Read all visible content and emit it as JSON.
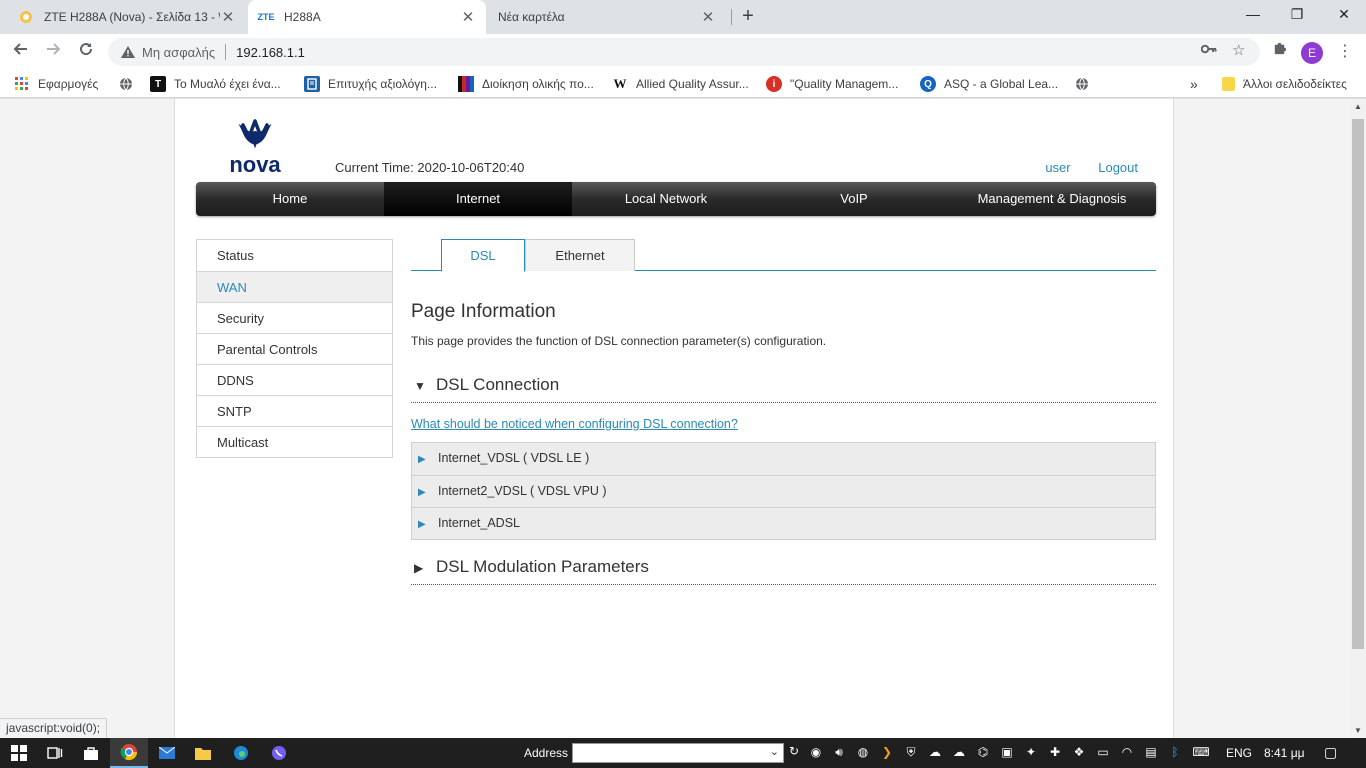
{
  "browser": {
    "tabs": [
      {
        "title": "ZTE H288A (Nova) - Σελίδα 13 - \\",
        "favicon": "forum-favicon",
        "active": false
      },
      {
        "title": "H288A",
        "favicon": "zte-favicon",
        "favicon_text": "ZTE",
        "active": true
      },
      {
        "title": "Νέα καρτέλα",
        "active": false
      }
    ],
    "new_tab": "+",
    "window_controls": {
      "minimize": "—",
      "restore": "❐",
      "close": "✕"
    },
    "omnibox": {
      "security_label": "Μη ασφαλής",
      "url": "192.168.1.1"
    },
    "profile_initial": "E",
    "bookmarks": [
      {
        "label": "Εφαρμογές",
        "icon": "apps-grid-icon"
      },
      {
        "label": "",
        "icon": "globe-icon"
      },
      {
        "label": "Το Μυαλό έχει ένα...",
        "icon": "t-logo-icon",
        "icon_text": "T",
        "color": "#111111"
      },
      {
        "label": "Επιτυχής αξιολόγη...",
        "icon": "book-icon",
        "color": "#1f5fa8"
      },
      {
        "label": "Διοίκηση ολικής πο...",
        "icon": "stripes-icon",
        "color": "#6a1b9a"
      },
      {
        "label": "Allied Quality Assur...",
        "icon": "wikipedia-icon",
        "icon_text": "W",
        "color": "#ffffff"
      },
      {
        "label": "\"Quality Managem...",
        "icon": "info-icon",
        "icon_text": "i",
        "color": "#d93025"
      },
      {
        "label": "ASQ - a Global Lea...",
        "icon": "asq-icon",
        "icon_text": "Q",
        "color": "#1565c0"
      },
      {
        "label": "",
        "icon": "globe-icon"
      }
    ],
    "bookmarks_overflow": "»",
    "other_bookmarks": "Άλλοι σελιδοδείκτες",
    "status_bubble": "javascript:void(0);"
  },
  "router": {
    "brand": "nova",
    "current_time_label": "Current Time:",
    "current_time": "2020-10-06T20:40",
    "user_link": "user",
    "logout_link": "Logout",
    "main_nav": [
      "Home",
      "Internet",
      "Local Network",
      "VoIP",
      "Management & Diagnosis"
    ],
    "main_nav_active": "Internet",
    "side_menu": [
      "Status",
      "WAN",
      "Security",
      "Parental Controls",
      "DDNS",
      "SNTP",
      "Multicast"
    ],
    "side_menu_active": "WAN",
    "sub_tabs": [
      "DSL",
      "Ethernet"
    ],
    "sub_tab_active": "DSL",
    "page_title": "Page Information",
    "page_description": "This page provides the function of DSL connection parameter(s) configuration.",
    "dsl_connection": {
      "heading": "DSL Connection",
      "expanded": true,
      "help_link": "What should be noticed when configuring DSL connection?",
      "connections": [
        "Internet_VDSL ( VDSL LE )",
        "Internet2_VDSL ( VDSL VPU )",
        "Internet_ADSL"
      ]
    },
    "dsl_modulation": {
      "heading": "DSL Modulation Parameters",
      "expanded": false
    },
    "colors": {
      "accent": "#2a8ab5",
      "nav_dark": "#1c1c1c",
      "logo_navy": "#0d2a6b"
    }
  },
  "taskbar": {
    "address_label": "Address",
    "language": "ENG",
    "clock": "8:41 μμ"
  }
}
